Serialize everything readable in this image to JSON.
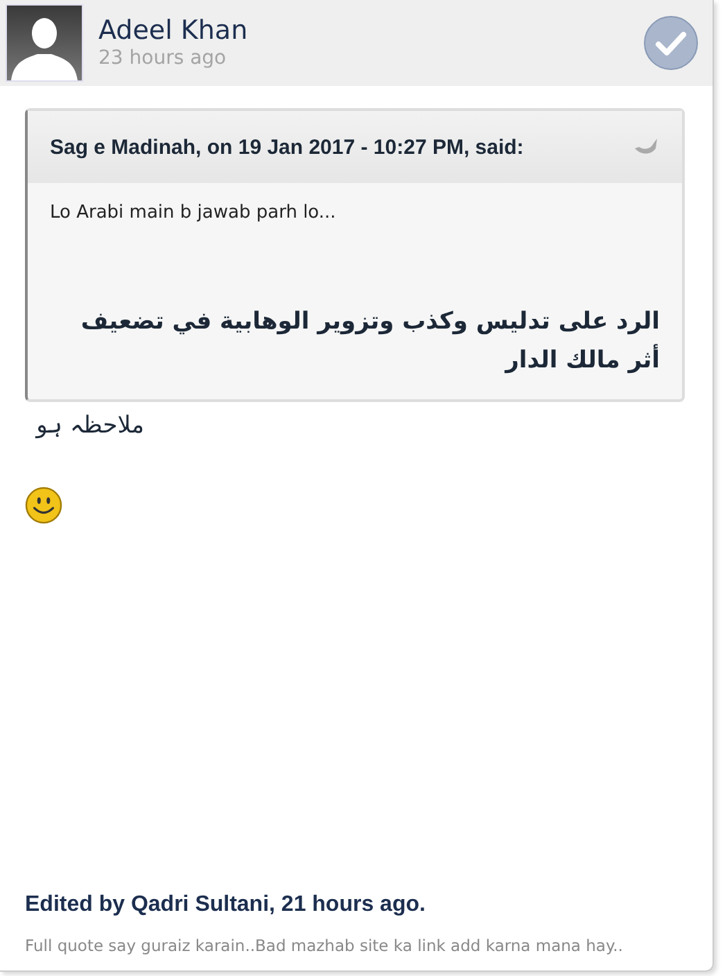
{
  "post": {
    "author": "Adeel Khan",
    "time": "23 hours ago"
  },
  "quote": {
    "citation": "Sag e Madinah, on 19 Jan 2017 - 10:27 PM, said:",
    "lines": [
      "Lo Arabi main b jawab parh lo...",
      "الرد على تدليس وكذب وتزوير الوهابية في تضعيف أثر مالك الدار"
    ]
  },
  "body": {
    "text": "ملاحظہ ہو"
  },
  "edit": {
    "title": "Edited by Qadri Sultani, 21 hours ago.",
    "reason": "Full quote say guraiz karain..Bad mazhab site ka link add karna mana hay.."
  }
}
